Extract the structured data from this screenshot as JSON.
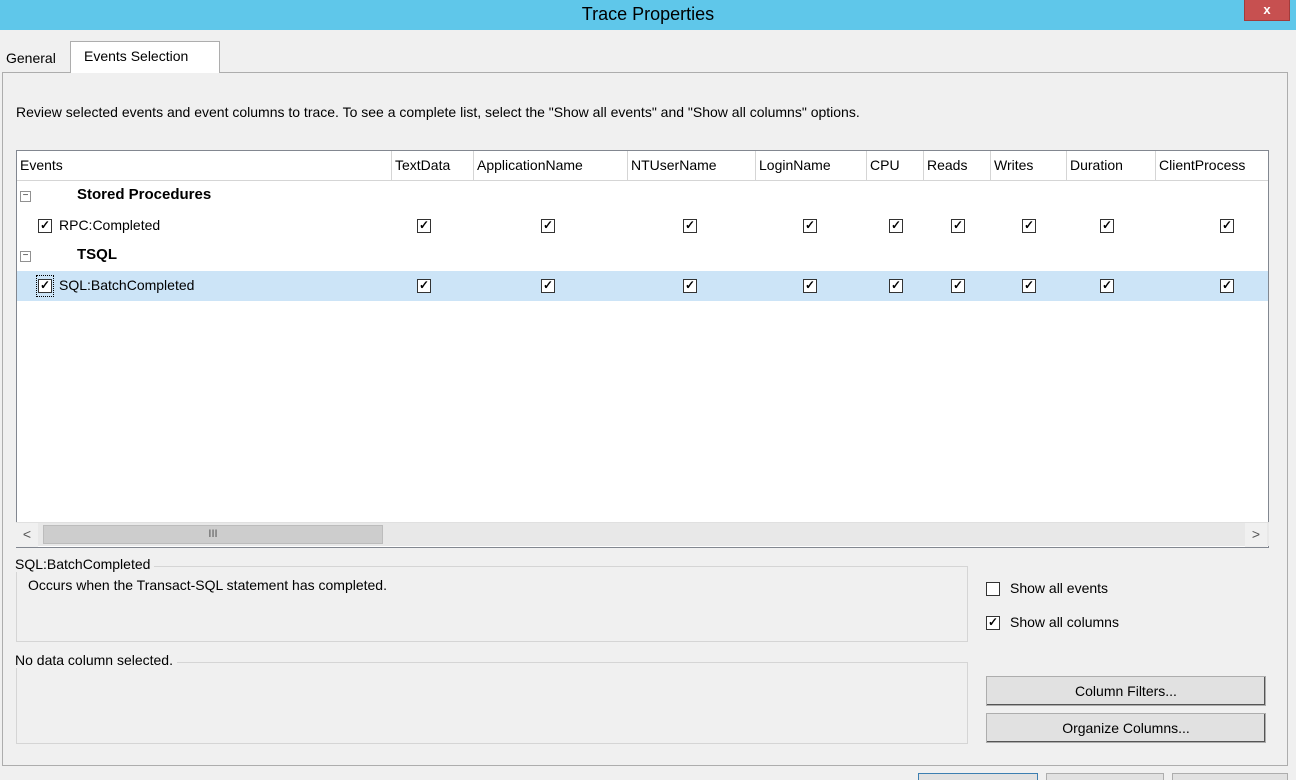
{
  "window": {
    "title": "Trace Properties",
    "close_glyph": "x"
  },
  "tabs": [
    {
      "label": "General",
      "active": false
    },
    {
      "label": "Events Selection",
      "active": true
    }
  ],
  "instructions": "Review selected events and event columns to trace. To see a complete list, select the \"Show all events\" and \"Show all columns\" options.",
  "grid": {
    "columns": [
      "Events",
      "TextData",
      "ApplicationName",
      "NTUserName",
      "LoginName",
      "CPU",
      "Reads",
      "Writes",
      "Duration",
      "ClientProcess"
    ],
    "groups": [
      {
        "name": "Stored Procedures",
        "expander": "−",
        "events": [
          {
            "name": "RPC:Completed",
            "checked": true,
            "selected": false
          }
        ]
      },
      {
        "name": "TSQL",
        "expander": "−",
        "events": [
          {
            "name": "SQL:BatchCompleted",
            "checked": true,
            "selected": true
          }
        ]
      }
    ],
    "check_glyph": "✓",
    "scroll_left": "<",
    "scroll_right": ">",
    "scroll_thumb_grip": "III"
  },
  "event_description": {
    "title": "SQL:BatchCompleted",
    "text": "Occurs when the Transact-SQL statement has completed."
  },
  "column_description": {
    "title": "No data column selected."
  },
  "options": {
    "show_all_events": {
      "label": "Show all events",
      "checked": false
    },
    "show_all_columns": {
      "label": "Show all columns",
      "checked": true
    }
  },
  "buttons": {
    "column_filters": "Column Filters...",
    "organize_columns": "Organize Columns..."
  }
}
